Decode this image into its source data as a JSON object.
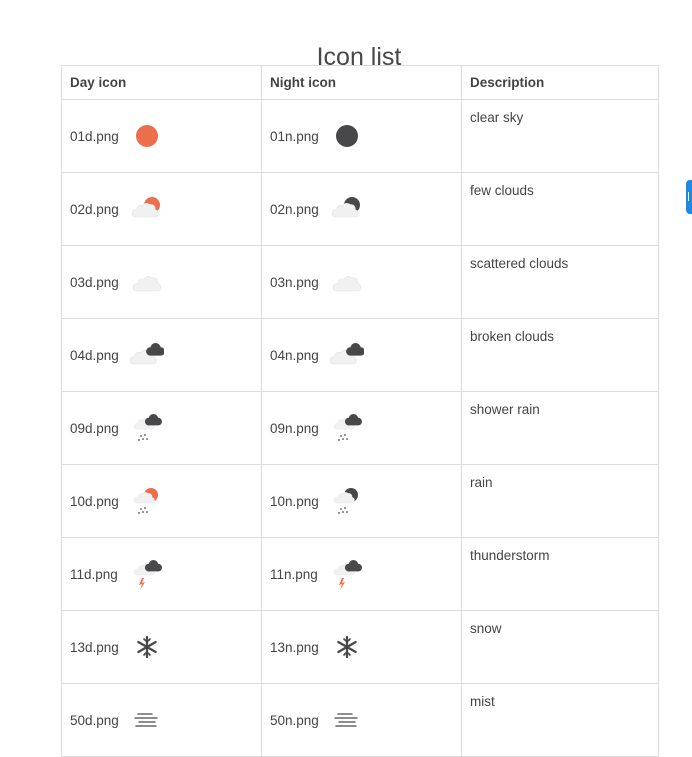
{
  "page": {
    "title": "Icon list"
  },
  "table": {
    "headers": {
      "day": "Day icon",
      "night": "Night icon",
      "description": "Description"
    },
    "rows": [
      {
        "day_file": "01d.png",
        "night_file": "01n.png",
        "description": "clear sky",
        "icon": "clear-sky-icon"
      },
      {
        "day_file": "02d.png",
        "night_file": "02n.png",
        "description": "few clouds",
        "icon": "few-clouds-icon"
      },
      {
        "day_file": "03d.png",
        "night_file": "03n.png",
        "description": "scattered clouds",
        "icon": "scattered-clouds-icon"
      },
      {
        "day_file": "04d.png",
        "night_file": "04n.png",
        "description": "broken clouds",
        "icon": "broken-clouds-icon"
      },
      {
        "day_file": "09d.png",
        "night_file": "09n.png",
        "description": "shower rain",
        "icon": "shower-rain-icon"
      },
      {
        "day_file": "10d.png",
        "night_file": "10n.png",
        "description": "rain",
        "icon": "rain-icon"
      },
      {
        "day_file": "11d.png",
        "night_file": "11n.png",
        "description": "thunderstorm",
        "icon": "thunderstorm-icon"
      },
      {
        "day_file": "13d.png",
        "night_file": "13n.png",
        "description": "snow",
        "icon": "snow-icon"
      },
      {
        "day_file": "50d.png",
        "night_file": "50n.png",
        "description": "mist",
        "icon": "mist-icon"
      }
    ]
  },
  "colors": {
    "day_accent": "#ec6e4c",
    "night_accent": "#48484a",
    "cloud_light": "#f1f1f1",
    "border": "#dcdcdc"
  }
}
